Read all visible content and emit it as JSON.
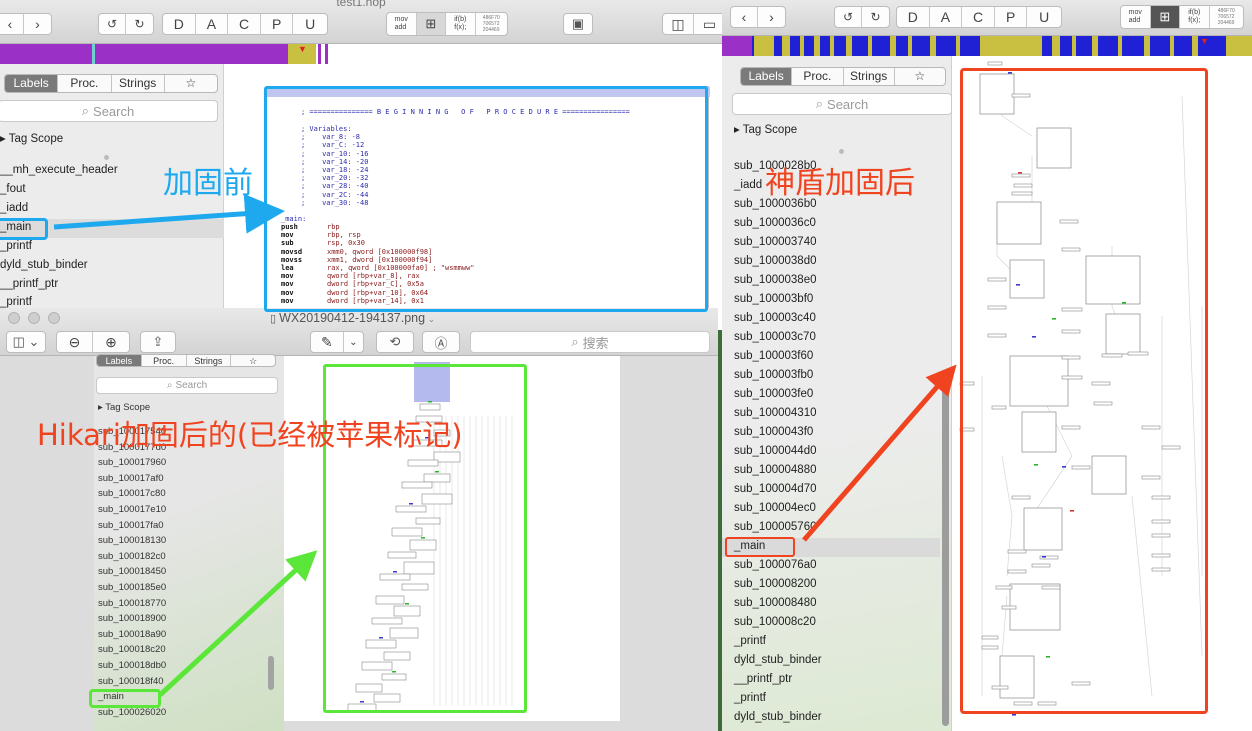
{
  "colors": {
    "cyan": "#1ea9ef",
    "green": "#5be63a",
    "red": "#f0431f",
    "nav_purple": "#9b30c7",
    "nav_olive": "#c9bf40",
    "nav_blue": "#2020d4"
  },
  "icons": [
    "back-icon",
    "forward-icon",
    "undo-icon",
    "redo-icon",
    "star-icon",
    "search-icon",
    "chip-icon",
    "sidebar-toggle-icon",
    "zoom-out-icon",
    "zoom-in-icon",
    "share-icon",
    "markup-icon",
    "rotate-icon",
    "annotate-icon",
    "file-icon",
    "arrow-icon"
  ],
  "toolbar": {
    "mode_letters": [
      "D",
      "A",
      "C",
      "P",
      "U"
    ],
    "mov_label": "mov\nadd",
    "iff_label": "if(b)\nf(x);",
    "hex_label": "486F70\n706572\n204469"
  },
  "window1": {
    "title": "test1.hop"
  },
  "sidebar": {
    "tabs": [
      "Labels",
      "Proc.",
      "Strings",
      "☆"
    ],
    "search_placeholder": "Search",
    "tag_scope": "Tag Scope"
  },
  "left_labels": [
    "__mh_execute_header",
    "_fout",
    "_iadd",
    "_main",
    "_printf",
    "dyld_stub_binder",
    "__printf_ptr",
    "_printf"
  ],
  "code": {
    "header": "; =============== B E G I N N I N G   O F   P R O C E D U R E ================",
    "vars": "; Variables:\n;    var_8: -8\n;    var_C: -12\n;    var_10: -16\n;    var_14: -20\n;    var_18: -24\n;    var_20: -32\n;    var_28: -40\n;    var_2C: -44\n;    var_30: -48",
    "label": "_main:",
    "mnemonics": "push\nmov\nsub\nmovsd\nmovss\nlea\nmov\nmov\nmov\nmov",
    "operands": "rbp\nrbp, rsp\nrsp, 0x30\nxmm0, qword [0x100000f98]\nxmm1, dword [0x100000f94]\nrax, qword [0x100000fa0] ; \"wsmmww\"\nqword [rbp+var_8], rax\ndword [rbp+var_C], 0x5a\ndword [rbp+var_10], 0x64\ndword [rbp+var_14], 0x1"
  },
  "preview": {
    "title": "WX20190412-194137.png",
    "search_placeholder": "搜索"
  },
  "inner_sidebar": {
    "tabs": [
      "Labels",
      "Proc.",
      "Strings",
      "☆"
    ],
    "search_placeholder": "Search",
    "tag_scope": "Tag Scope",
    "items": [
      "sub_100017540",
      "sub_1000177d0",
      "sub_100017960",
      "sub_100017af0",
      "sub_100017c80",
      "sub_100017e10",
      "sub_100017fa0",
      "sub_100018130",
      "sub_1000182c0",
      "sub_100018450",
      "sub_1000185e0",
      "sub_100018770",
      "sub_100018900",
      "sub_100018a90",
      "sub_100018c20",
      "sub_100018db0",
      "sub_100018f40",
      "_main",
      "sub_100026020"
    ]
  },
  "right_sidebar": {
    "tabs": [
      "Labels",
      "Proc.",
      "Strings",
      "☆"
    ],
    "search_placeholder": "Search",
    "tag_scope": "Tag Scope",
    "items": [
      "sub_1000028b0",
      "_iadd",
      "sub_1000036b0",
      "sub_1000036c0",
      "sub_100003740",
      "sub_1000038d0",
      "sub_1000038e0",
      "sub_100003bf0",
      "sub_100003c40",
      "sub_100003c70",
      "sub_100003f60",
      "sub_100003fb0",
      "sub_100003fe0",
      "sub_100004310",
      "sub_1000043f0",
      "sub_1000044d0",
      "sub_100004880",
      "sub_100004d70",
      "sub_100004ec0",
      "sub_100005760",
      "_main",
      "sub_1000076a0",
      "sub_100008200",
      "sub_100008480",
      "sub_100008c20",
      "_printf",
      "dyld_stub_binder",
      "__printf_ptr",
      "_printf",
      "dyld_stub_binder"
    ]
  },
  "annotations": {
    "before": "加固前",
    "hikari": "Hikari加固后的(已经被苹果标记)",
    "shendun": "神盾加固后"
  }
}
